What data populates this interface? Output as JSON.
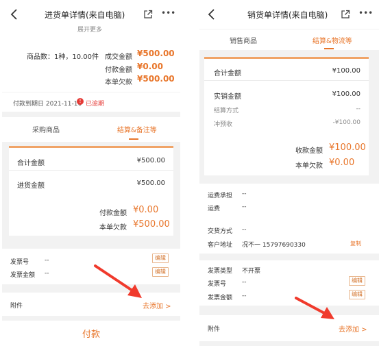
{
  "left": {
    "header": {
      "title": "进货单详情(来自电脑)"
    },
    "summary": {
      "collapsed_hint": "展开更多",
      "goods_count": "商品数：1种，10.00件",
      "deal_label": "成交金额",
      "deal_value": "¥500.00",
      "paid_label": "付款金额",
      "paid_value": "¥0.00",
      "owed_label": "本单欠款",
      "owed_value": "¥500.00"
    },
    "due": {
      "text": "付款到期日 2021-11-16",
      "overdue": "已逾期"
    },
    "tabs": [
      "采购商品",
      "结算&备注等"
    ],
    "settle": {
      "total_label": "合计金额",
      "total_value": "¥500.00",
      "purchase_label": "进货金额",
      "purchase_value": "¥500.00",
      "paid_label": "付款金额",
      "paid_value": "¥0.00",
      "owed_label": "本单欠款",
      "owed_value": "¥500.00"
    },
    "invoice": {
      "no_label": "发票号",
      "no_value": "--",
      "amount_label": "发票金额",
      "amount_value": "--",
      "edit": "编辑"
    },
    "attachment": {
      "label": "附件",
      "action": "去添加 >"
    },
    "pay_button": "付款"
  },
  "right": {
    "header": {
      "title": "销货单详情(来自电脑)"
    },
    "tabs": [
      "销售商品",
      "结算&物流等"
    ],
    "settle": {
      "total_label": "合计金额",
      "total_value": "¥100.00",
      "actual_label": "实销金额",
      "actual_value": "¥100.00",
      "method_label": "结算方式",
      "method_value": "--",
      "offset_label": "冲预收",
      "offset_value": "-¥100.00",
      "received_label": "收款金额",
      "received_value": "¥100.00",
      "owed_label": "本单欠款",
      "owed_value": "¥0.00"
    },
    "shipping": {
      "bear_label": "运费承担",
      "bear_value": "--",
      "fee_label": "运费",
      "fee_value": "--",
      "delivery_label": "交货方式",
      "delivery_value": "--",
      "addr_label": "客户地址",
      "addr_value": "况不一 15797690330",
      "copy": "复制"
    },
    "invoice": {
      "type_label": "发票类型",
      "type_value": "不开票",
      "no_label": "发票号",
      "no_value": "--",
      "amount_label": "发票金额",
      "amount_value": "--",
      "edit": "编辑"
    },
    "attachment": {
      "label": "附件",
      "action": "去添加 >"
    }
  },
  "colors": {
    "accent": "#e8762b",
    "arrow": "#f03a2c",
    "card_top": "#f0a468"
  }
}
